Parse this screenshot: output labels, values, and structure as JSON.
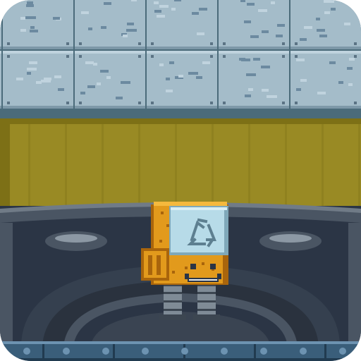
{
  "scene": {
    "background": "#ffffff",
    "icon": {
      "style": "rounded-square pixel-art game icon",
      "colors": {
        "stone_tile": "#a4bcc9",
        "stone_tile_light": "#c0d3de",
        "stone_tile_dark": "#7d98a8",
        "stone_spot": "#6c8aa0",
        "stone_grout": "#4b6b7a",
        "rivet": "#5b7384",
        "olive_wall": "#998a24",
        "olive_wall_shade": "#7d7016",
        "machine_dark": "#2b3545",
        "machine_mid": "#4a5563",
        "machine_light": "#707b87",
        "machine_highlight": "#8c98a4",
        "floor_metal": "#3a5e7a",
        "floor_metal_light": "#6d93b1",
        "floor_metal_dark": "#213b50",
        "robot_body": "#e29a1c",
        "robot_body_light": "#f5b93d",
        "robot_body_dark": "#a9650c",
        "robot_screen": "#b7dbe8",
        "robot_screen_dark": "#7fa8b9",
        "robot_screen_symbol": "#5d7f90",
        "robot_legs": "#7f8b96",
        "robot_legs_dark": "#3c4651"
      }
    },
    "robot": {
      "screen_icon": "recycle-arrows-icon",
      "face": "smile"
    }
  }
}
